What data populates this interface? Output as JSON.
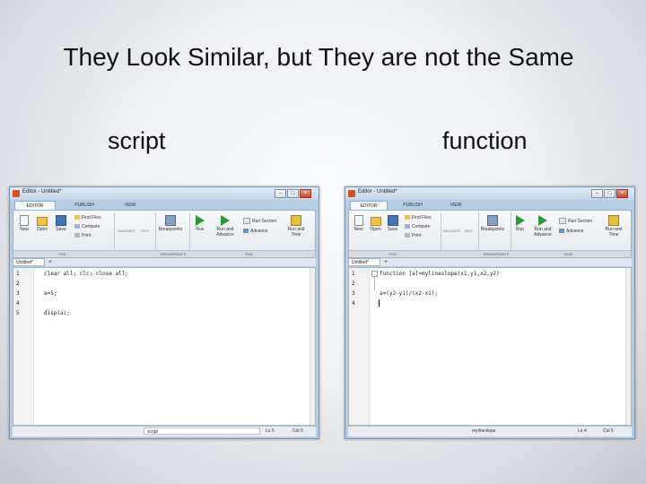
{
  "slide": {
    "title": "They Look Similar, but They are not the Same",
    "left_label": "script",
    "right_label": "function"
  },
  "windows": [
    {
      "title": "Editor - Untitled*",
      "tabs": [
        "EDITOR",
        "PUBLISH",
        "VIEW"
      ],
      "file_tools": {
        "new": "New",
        "open": "Open",
        "save": "Save"
      },
      "find_files": "Find Files",
      "compare": "Compare",
      "print": "Print",
      "navigate": "NAVIGATE",
      "edit": "EDIT",
      "breakpoints": "Breakpoints",
      "run": "Run",
      "run_advance": "Run and Advance",
      "run_section": "Run Section",
      "advance": "Advance",
      "run_time": "Run and Time",
      "groups": {
        "file": "FILE",
        "breakpoints": "BREAKPOINTS",
        "run": "RUN"
      },
      "doc_tab": "Untitled*",
      "code_lines": [
        "clear all; clc; close all;",
        "",
        "a=5;",
        "",
        "disp(a);"
      ],
      "line_numbers": [
        "1",
        "2",
        "3",
        "4",
        "5"
      ],
      "status": {
        "name": "script",
        "ln": "Ln 5",
        "col": "Col 9"
      }
    },
    {
      "title": "Editor - Untitled*",
      "tabs": [
        "EDITOR",
        "PUBLISH",
        "VIEW"
      ],
      "file_tools": {
        "new": "New",
        "open": "Open",
        "save": "Save"
      },
      "find_files": "Find Files",
      "compare": "Compare",
      "print": "Print",
      "navigate": "NAVIGATE",
      "edit": "EDIT",
      "breakpoints": "Breakpoints",
      "run": "Run",
      "run_advance": "Run and Advance",
      "run_section": "Run Section",
      "advance": "Advance",
      "run_time": "Run and Time",
      "groups": {
        "file": "FILE",
        "breakpoints": "BREAKPOINTS",
        "run": "RUN"
      },
      "doc_tab": "Untitled*",
      "code_lines": [
        "function [a]=mylineslope(x1,y1,x2,y2)",
        "",
        "a=(y2-y1)/(x2-x1);",
        ""
      ],
      "line_numbers": [
        "1",
        "2",
        "3",
        "4"
      ],
      "status": {
        "name": "mylineslope",
        "ln": "Ln 4",
        "col": "Col 5"
      }
    }
  ]
}
